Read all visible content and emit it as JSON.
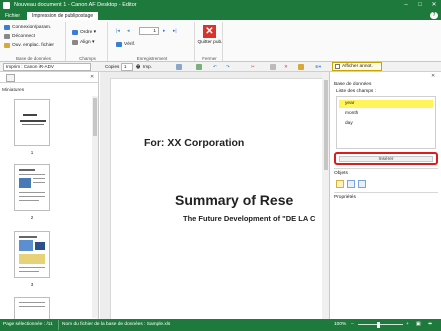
{
  "window": {
    "title": "Nouveau document 1 - Canon AF Desktop - Editor"
  },
  "tabs": {
    "file": "Fichier",
    "active": "Impression de publipostage",
    "help": "?"
  },
  "ribbon": {
    "db_group": {
      "label": "Base de données",
      "items": [
        "Connexion/param.",
        "Déconnect",
        "Ouv. emplac. fichier"
      ]
    },
    "fields_group": {
      "label": "Champs",
      "items": [
        "Ordre",
        "Align"
      ]
    },
    "record_group": {
      "label": "Enregistrement",
      "verify": "Vérif.",
      "current": "1"
    },
    "close_group": {
      "label": "Fermer",
      "quit": "Quitter pub."
    }
  },
  "toolbar": {
    "printer": "Imprim : Canon iR-ADV",
    "copies_label": "Copies",
    "copies_value": "1",
    "print_label": "Imp.",
    "annot_label": "Afficher annot."
  },
  "left_panel": {
    "title": "Miniatures",
    "pages": [
      "1",
      "2",
      "3"
    ]
  },
  "page": {
    "for_line": "For: XX Corporation",
    "title": "Summary of Rese",
    "subtitle": "The Future Development of \"DE LA C"
  },
  "right_panel": {
    "db_title": "Base de données",
    "fields_title": "Liste des champs :",
    "fields": [
      "year",
      "month",
      "day"
    ],
    "selected_index": 0,
    "insert": "Insérer",
    "objects_title": "Objets",
    "properties_title": "Propriétés"
  },
  "status": {
    "selected_page": "Page sélectionnée : /11",
    "db_file": "Nom du fichier de la base de données : Sample.xls",
    "zoom": "100%",
    "zoom_level": 0.45
  },
  "colors": {
    "accent": "#1e7a3c",
    "highlight": "#fff45a",
    "callout": "#d91e1e"
  }
}
